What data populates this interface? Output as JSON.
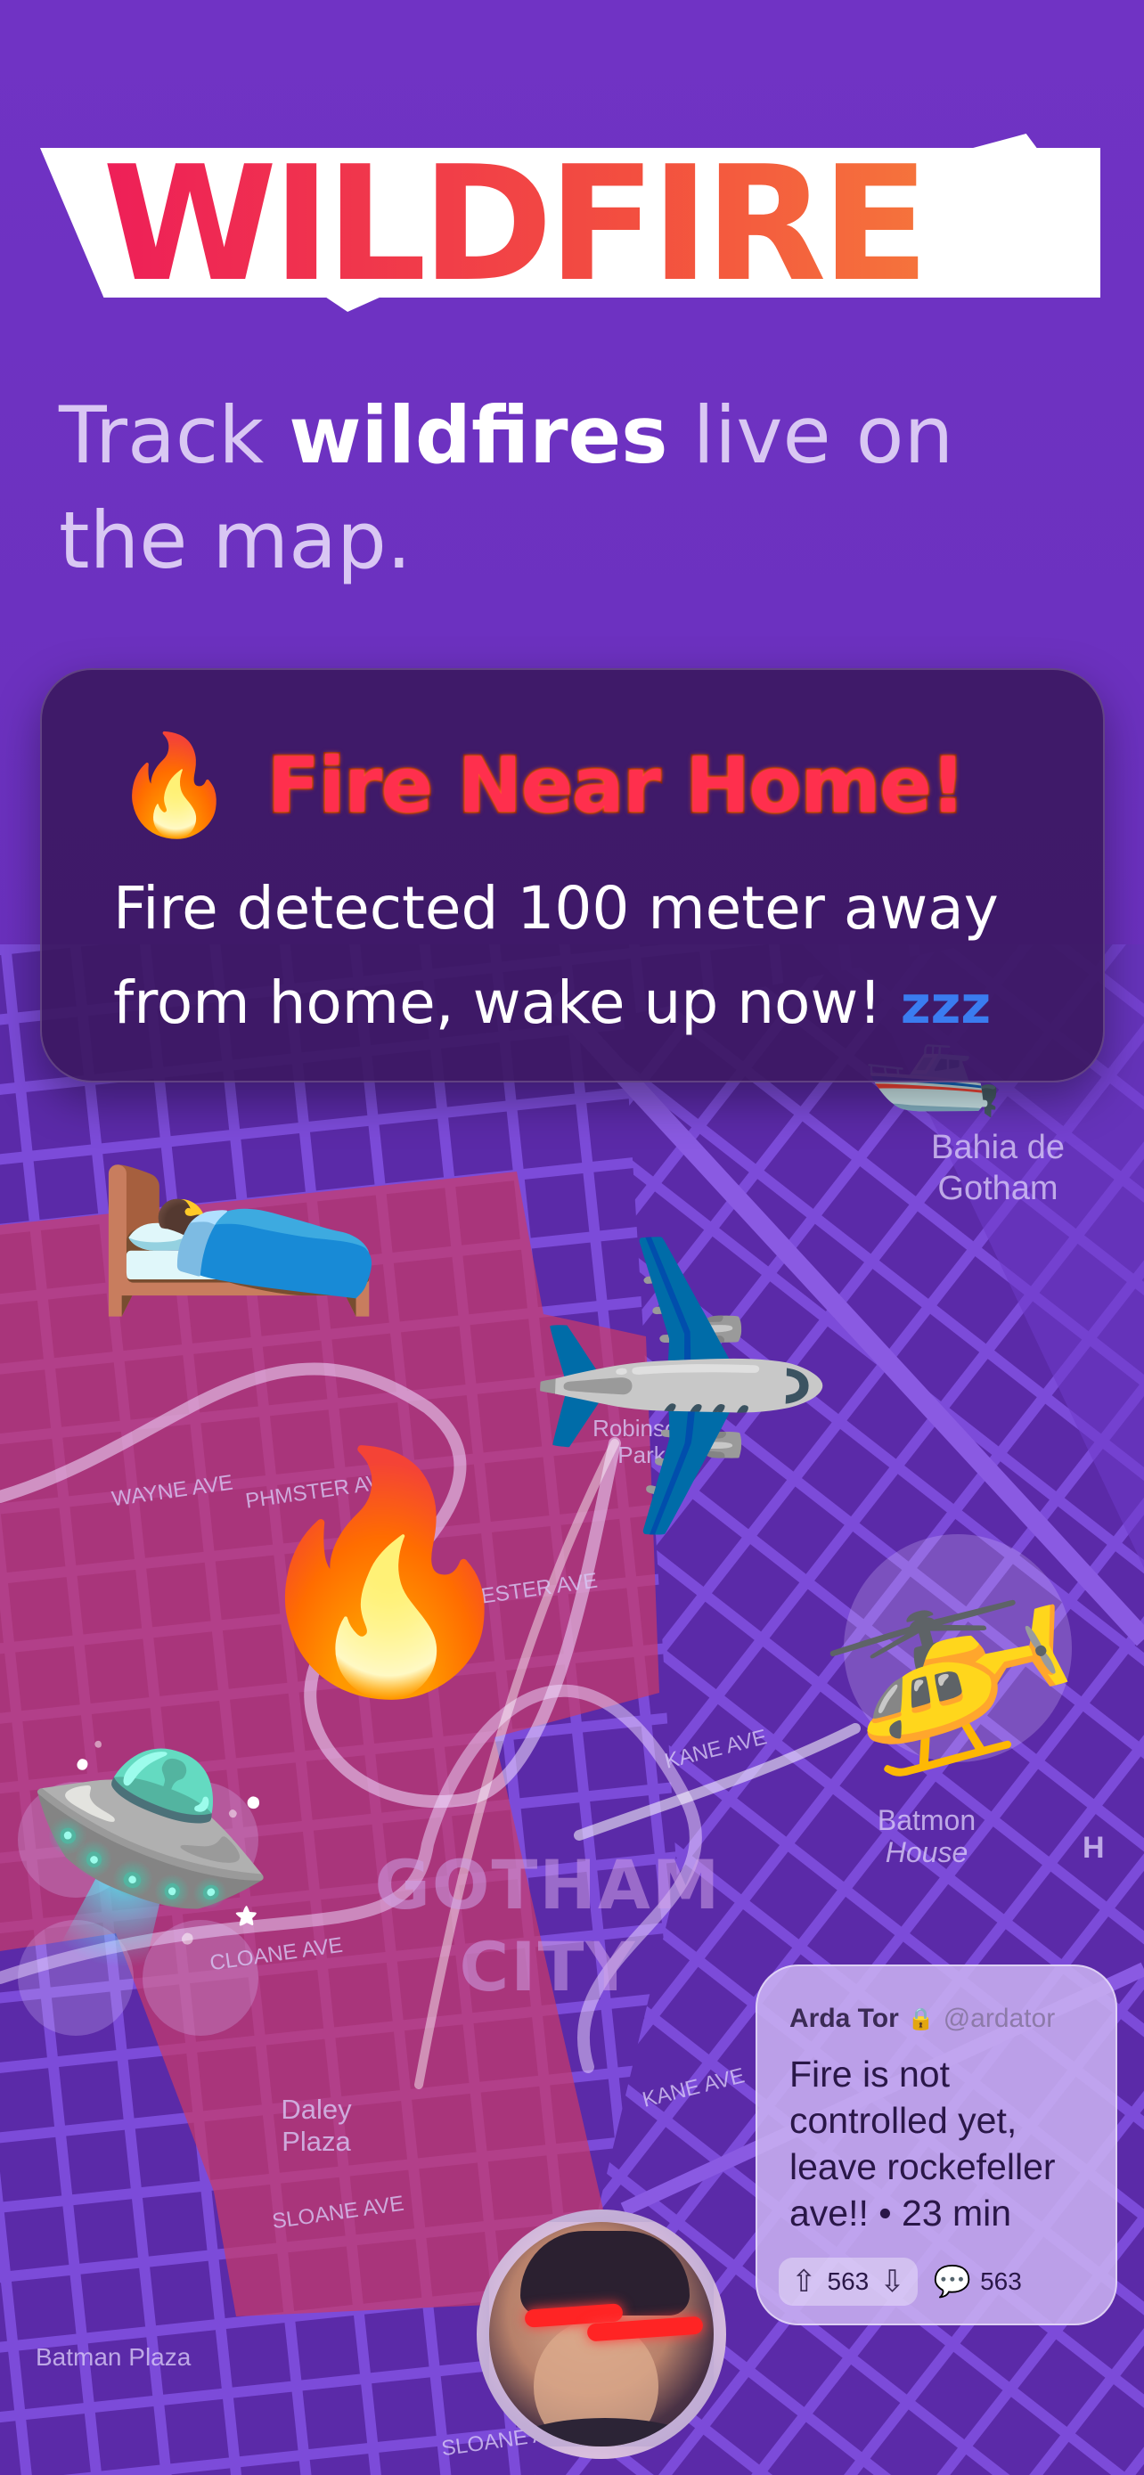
{
  "logo": {
    "text": "WILDFIRE"
  },
  "tagline": {
    "part1": "Track ",
    "bold": "wildfires",
    "part2": " live on the map."
  },
  "alert": {
    "emoji": "🔥",
    "title": "Fire Near Home!",
    "body": "Fire detected 100 meter away from home, wake up now!",
    "zzz": "zzz"
  },
  "map": {
    "labels": {
      "bahia": "Bahia de Gotham",
      "batmon_house_1": "Batmon",
      "batmon_house_2": "House",
      "h_marker": "H",
      "daley_plaza": "Daley Plaza",
      "batman_plaza": "Batman Plaza",
      "robinson_park": "Robinson Park",
      "city_1": "GOTHAM",
      "city_2": "CITY",
      "streets": [
        "WAYNE AVE",
        "PHMSTER AVE",
        "CHESTER AVE",
        "KANE AVE",
        "CLOANE AVE",
        "SLOANE AVE",
        "KANE AVE",
        "SLOANE AVE"
      ]
    },
    "icons": [
      "statue-of-liberty-icon",
      "boat-icon",
      "bed-sleeping-icon",
      "airplane-icon",
      "helicopter-icon",
      "drone-icon",
      "fire-icon"
    ],
    "colors": {
      "fire_zone": "#c83a6a",
      "street": "#7a48d6",
      "block": "#5a2aa6"
    }
  },
  "tweet": {
    "name": "Arda Tor",
    "handle": "@ardator",
    "body": "Fire is not controlled yet, leave rockefeller ave!! • 23 min",
    "upvotes": "563",
    "replies": "563"
  }
}
